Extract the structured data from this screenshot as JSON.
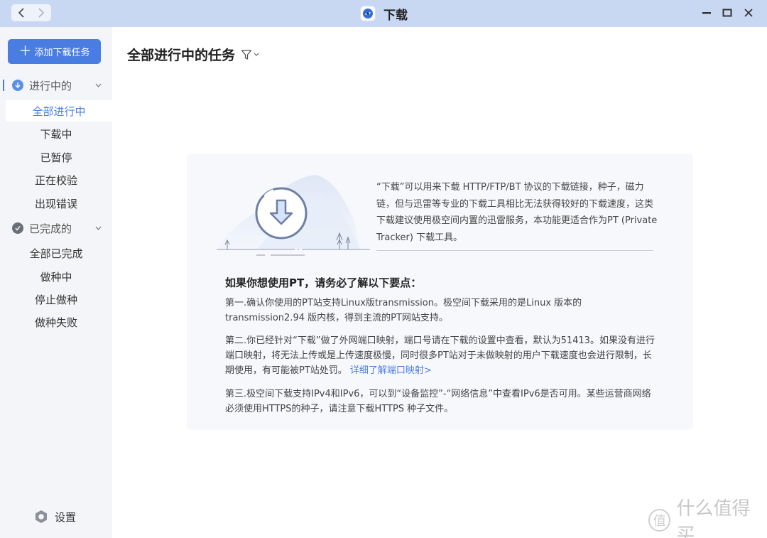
{
  "titlebar": {
    "back_icon": "chevron-left-icon",
    "forward_icon": "chevron-right-icon",
    "title": "下载",
    "minimize_glyph": "▬",
    "maximize_glyph": "■",
    "close_glyph": "✕"
  },
  "sidebar": {
    "add_task_label": "添加下载任务",
    "groups": [
      {
        "label": "进行中的",
        "icon": "download-circle-icon",
        "items": [
          "全部进行中",
          "下载中",
          "已暂停",
          "正在校验",
          "出现错误"
        ]
      },
      {
        "label": "已完成的",
        "icon": "check-circle-icon",
        "items": [
          "全部已完成",
          "做种中",
          "停止做种",
          "做种失败"
        ]
      }
    ],
    "active_item": "全部进行中",
    "settings_label": "设置"
  },
  "main": {
    "title": "全部进行中的任务",
    "intro": "“下载”可以用来下载 HTTP/FTP/BT 协议的下载链接，种子，磁力链，但与迅雷等专业的下载工具相比无法获得较好的下载速度，这类下载建议使用极空间内置的迅雷服务，本功能更适合作为PT (Private Tracker) 下载工具。",
    "pt_heading": "如果你想使用PT，请务必了解以下要点：",
    "points": [
      "第一.确认你使用的PT站支持Linux版transmission。极空间下载采用的是Linux 版本的 transmission2.94 版内核，得到主流的PT网站支持。",
      "第二.你已经针对“下载”做了外网端口映射，端口号请在下载的设置中查看，默认为51413。如果没有进行端口映射，将无法上传或是上传速度极慢，同时很多PT站对于未做映射的用户下载速度也会进行限制，长期使用，有可能被PT站处罚。",
      "第三.极空间下载支持IPv4和IPv6，可以到“设备监控”-“网络信息”中查看IPv6是否可用。某些运营商网络必须使用HTTPS的种子，请注意下载HTTPS 种子文件。"
    ],
    "point2_link": "详细了解端口映射>"
  },
  "watermark": {
    "badge": "值",
    "text": "什么值得买"
  },
  "colors": {
    "accent": "#4a7de2",
    "titlebar": "#c8d8f2",
    "sidebar": "#f4f5f8",
    "panel": "#f7f8fc"
  }
}
